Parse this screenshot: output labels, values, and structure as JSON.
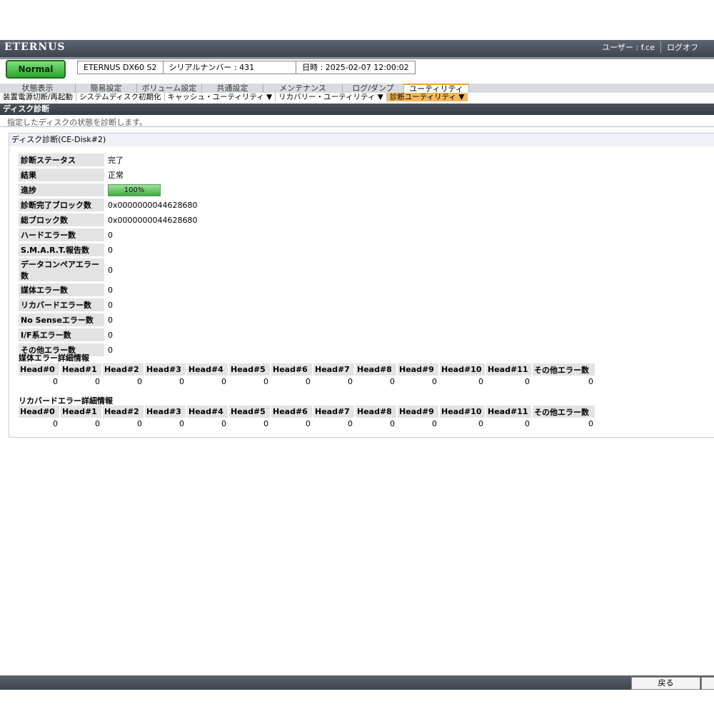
{
  "header": {
    "brand": "ETERNUS",
    "user_label": "ユーザー : f.ce",
    "logoff_label": "ログオフ"
  },
  "status": {
    "label": "Normal"
  },
  "device": {
    "model": "ETERNUS DX60 S2",
    "serial_prefix": "シリアルナンバー : 431",
    "datetime": "日時 : 2025-02-07 12:00:02"
  },
  "tabs": [
    {
      "label": "状態表示"
    },
    {
      "label": "簡易設定"
    },
    {
      "label": "ボリューム設定"
    },
    {
      "label": "共通設定"
    },
    {
      "label": "メンテナンス"
    },
    {
      "label": "ログ/ダンプ"
    },
    {
      "label": "ユーティリティ"
    }
  ],
  "subtabs": [
    {
      "label": "装置電源切断/再起動"
    },
    {
      "label": "システムディスク初期化"
    },
    {
      "label": "キャッシュ・ユーティリティ ▼"
    },
    {
      "label": "リカバリー・ユーティリティ ▼"
    },
    {
      "label": "診断ユーティリティ ▼"
    }
  ],
  "page": {
    "title": "ディスク診断",
    "description": "指定したディスクの状態を診断します。"
  },
  "panel": {
    "title": "ディスク診断(CE-Disk#2)",
    "rows": [
      {
        "label": "診断ステータス",
        "value": "完了"
      },
      {
        "label": "結果",
        "value": "正常"
      },
      {
        "label": "進捗",
        "value": "100%"
      },
      {
        "label": "診断完了ブロック数",
        "value": "0x0000000044628680"
      },
      {
        "label": "総ブロック数",
        "value": "0x0000000044628680"
      },
      {
        "label": "ハードエラー数",
        "value": "0"
      },
      {
        "label": "S.M.A.R.T.報告数",
        "value": "0"
      },
      {
        "label": "データコンペアエラー数",
        "value": "0"
      },
      {
        "label": "媒体エラー数",
        "value": "0"
      },
      {
        "label": "リカバードエラー数",
        "value": "0"
      },
      {
        "label": "No Senseエラー数",
        "value": "0"
      },
      {
        "label": "I/F系エラー数",
        "value": "0"
      },
      {
        "label": "その他エラー数",
        "value": "0"
      }
    ],
    "progress_fraction": 1.0
  },
  "media_errors": {
    "title": "媒体エラー詳細情報",
    "headers": [
      "Head#0",
      "Head#1",
      "Head#2",
      "Head#3",
      "Head#4",
      "Head#5",
      "Head#6",
      "Head#7",
      "Head#8",
      "Head#9",
      "Head#10",
      "Head#11",
      "その他エラー数"
    ],
    "values": [
      "0",
      "0",
      "0",
      "0",
      "0",
      "0",
      "0",
      "0",
      "0",
      "0",
      "0",
      "0",
      "0"
    ]
  },
  "recovered_errors": {
    "title": "リカバードエラー詳細情報",
    "headers": [
      "Head#0",
      "Head#1",
      "Head#2",
      "Head#3",
      "Head#4",
      "Head#5",
      "Head#6",
      "Head#7",
      "Head#8",
      "Head#9",
      "Head#10",
      "Head#11",
      "その他エラー数"
    ],
    "values": [
      "0",
      "0",
      "0",
      "0",
      "0",
      "0",
      "0",
      "0",
      "0",
      "0",
      "0",
      "0",
      "0"
    ]
  },
  "footer": {
    "back_label": "戻る"
  }
}
